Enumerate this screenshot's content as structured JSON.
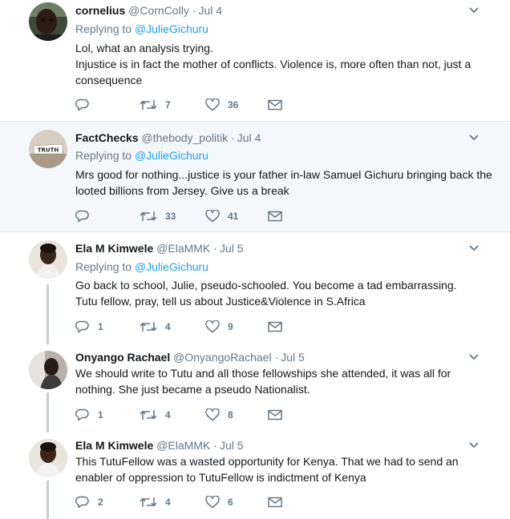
{
  "tweets": [
    {
      "name": "cornelius",
      "handle": "@CornColly",
      "date": "Jul 4",
      "replying_prefix": "Replying to",
      "replying_to": "@JulieGichuru",
      "text": "Lol, what an analysis trying.\nInjustice is in fact the mother of conflicts. Violence is, more often than not, just a consequence",
      "replies": "",
      "retweets": "7",
      "likes": "36"
    },
    {
      "name": "FactChecks",
      "handle": "@thebody_politik",
      "date": "Jul 4",
      "avatar_text": "TRUTH",
      "replying_prefix": "Replying to",
      "replying_to": "@JulieGichuru",
      "text": "Mrs good for nothing...justice is your father in-law Samuel Gichuru bringing back the looted billions from Jersey. Give us a break",
      "replies": "",
      "retweets": "33",
      "likes": "41"
    },
    {
      "name": "Ela M Kimwele",
      "handle": "@ElaMMK",
      "date": "Jul 5",
      "replying_prefix": "Replying to",
      "replying_to": "@JulieGichuru",
      "text": "Go back to school, Julie, pseudo-schooled. You become a tad embarrassing.\nTutu fellow, pray, tell us about Justice&Violence in S.Africa",
      "replies": "1",
      "retweets": "4",
      "likes": "9"
    },
    {
      "name": "Onyango Rachael",
      "handle": "@OnyangoRachael",
      "date": "Jul 5",
      "text": "We should write to Tutu and all those fellowships she attended,  it was all for nothing.  She just became a pseudo Nationalist.",
      "replies": "1",
      "retweets": "4",
      "likes": "8"
    },
    {
      "name": "Ela M Kimwele",
      "handle": "@ElaMMK",
      "date": "Jul 5",
      "text": "This TutuFellow was a wasted opportunity for Kenya. That we had to send an enabler of oppression to TutuFellow is indictment of Kenya",
      "replies": "2",
      "retweets": "4",
      "likes": "6"
    }
  ],
  "colors": {
    "link": "#1da1f2",
    "secondary": "#657786",
    "highlight_bg": "#f5f8fa",
    "thread_line": "#c4cfd6"
  },
  "icons": [
    "reply-icon",
    "retweet-icon",
    "like-icon",
    "message-icon",
    "chevron-down-icon"
  ]
}
